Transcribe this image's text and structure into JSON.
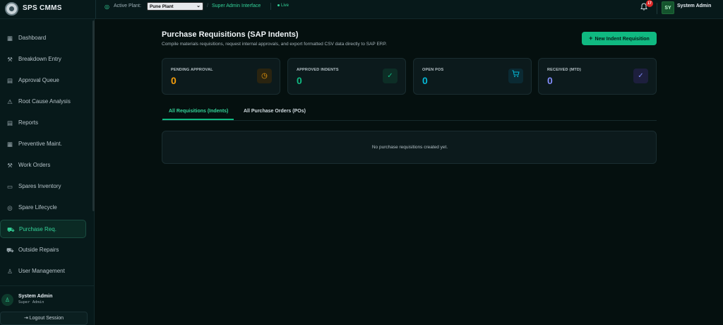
{
  "app": {
    "name": "SPS CMMS"
  },
  "topbar": {
    "active_plant_label": "Active Plant:",
    "plant_selected": "Pune Plant",
    "separator": "/",
    "interface_label": "Super Admin Interface",
    "live_label": "Live",
    "notification_count": "17",
    "avatar_initials": "SY",
    "user_name": "System Admin"
  },
  "sidebar": {
    "items": [
      {
        "label": "Dashboard",
        "icon": "grid-icon"
      },
      {
        "label": "Breakdown Entry",
        "icon": "wrench-icon"
      },
      {
        "label": "Approval Queue",
        "icon": "document-icon"
      },
      {
        "label": "Root Cause Analysis",
        "icon": "warning-icon"
      },
      {
        "label": "Reports",
        "icon": "report-icon"
      },
      {
        "label": "Preventive Maint.",
        "icon": "calendar-icon"
      },
      {
        "label": "Work Orders",
        "icon": "wrench-icon"
      },
      {
        "label": "Spares Inventory",
        "icon": "database-icon"
      },
      {
        "label": "Spare Lifecycle",
        "icon": "compass-icon"
      },
      {
        "label": "Purchase Req.",
        "icon": "cart-icon"
      },
      {
        "label": "Outside Repairs",
        "icon": "truck-icon"
      },
      {
        "label": "User Management",
        "icon": "user-icon"
      }
    ],
    "active_index": 9,
    "footer": {
      "user_name": "System Admin",
      "role": "Super Admin",
      "logout_label": "Logout Session"
    }
  },
  "main": {
    "title": "Purchase Requisitions (SAP Indents)",
    "subtitle": "Compile materials requisitions, request internal approvals, and export formatted CSV data directly to SAP ERP.",
    "new_button_label": "New Indent Requisition",
    "stats": [
      {
        "label": "PENDING APPROVAL",
        "value": "0",
        "color": "#f59e0b",
        "icon": "clock-icon"
      },
      {
        "label": "APPROVED INDENTS",
        "value": "0",
        "color": "#10b981",
        "icon": "check-circle-icon"
      },
      {
        "label": "OPEN POS",
        "value": "0",
        "color": "#06b6d4",
        "icon": "cart-icon"
      },
      {
        "label": "RECEIVED (MTD)",
        "value": "0",
        "color": "#818cf8",
        "icon": "check-circle-icon"
      }
    ],
    "tabs": [
      {
        "label": "All Requisitions (Indents)",
        "active": true
      },
      {
        "label": "All Purchase Orders (POs)",
        "active": false
      }
    ],
    "empty_message": "No purchase requisitions created yet."
  },
  "colors": {
    "accent": "#10b981",
    "background": "#05100f",
    "sidebar": "#07191a",
    "card": "#0c1a1c"
  }
}
